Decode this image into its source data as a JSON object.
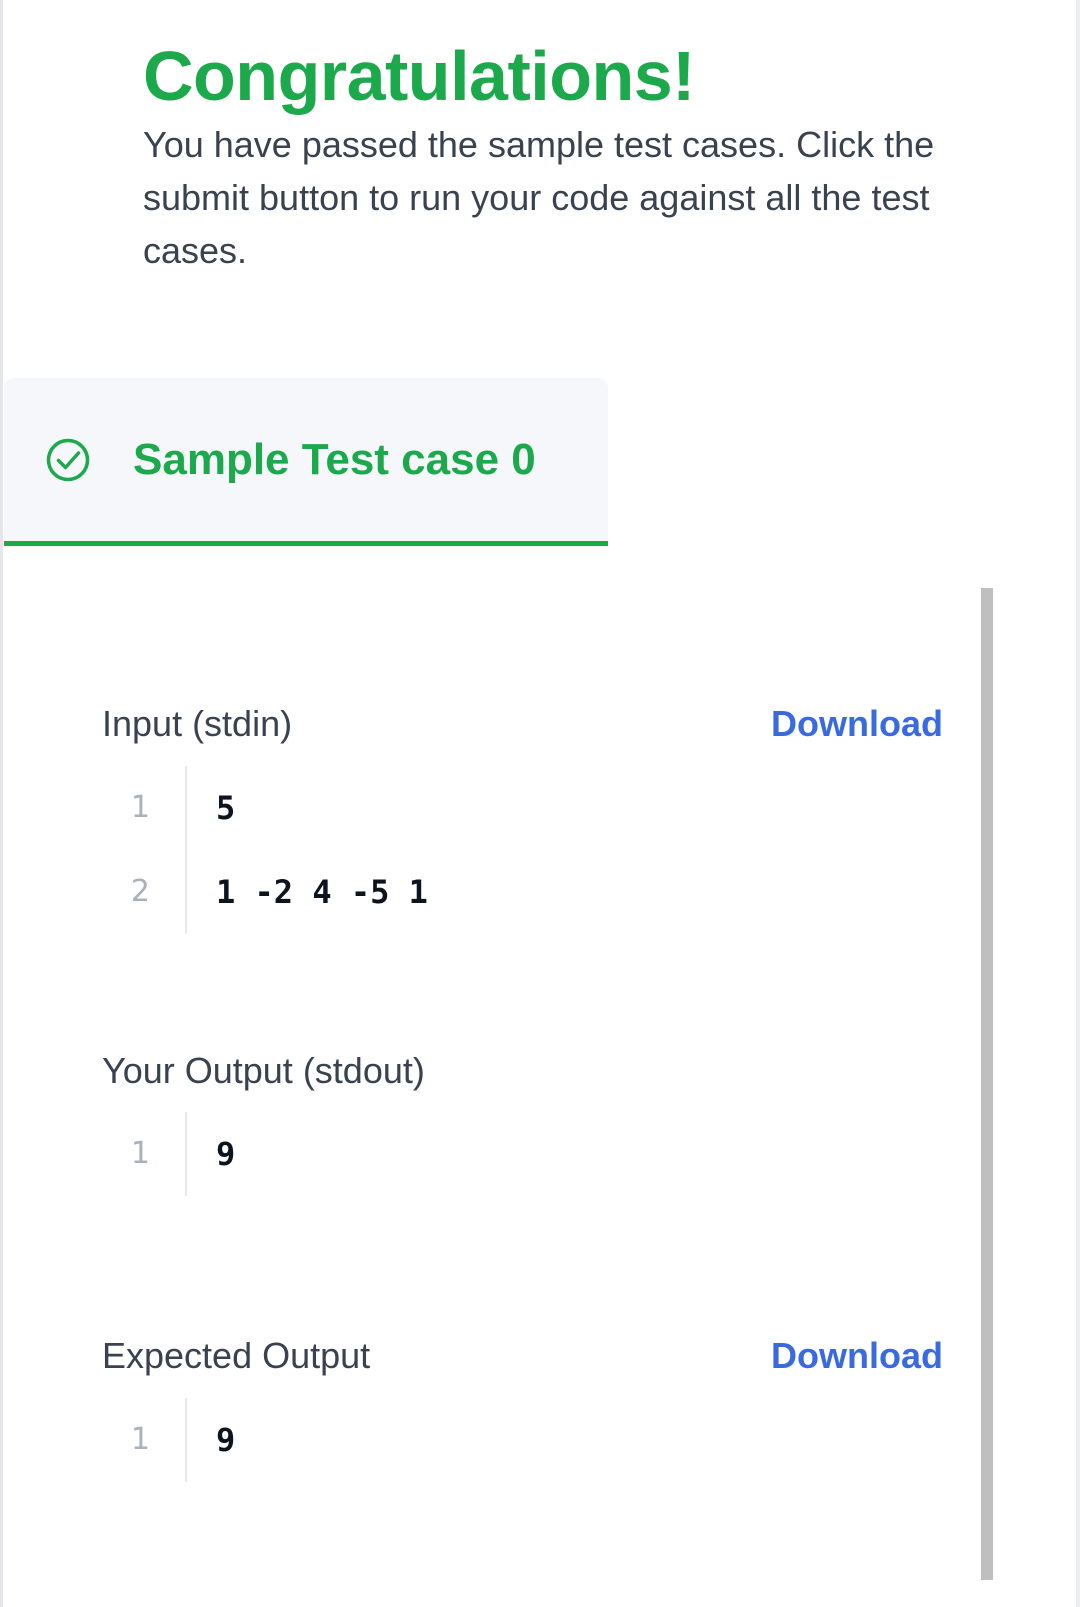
{
  "header": {
    "title": "Congratulations!",
    "message": "You have passed the sample test cases. Click the submit button to run your code against all the test cases."
  },
  "tabs": [
    {
      "label": "Sample Test case 0",
      "status": "passed",
      "icon": "check-circle-icon",
      "selected": true
    }
  ],
  "colors": {
    "success": "#1ba94c",
    "link": "#3a6ae0",
    "tab_background": "#f5f7fb"
  },
  "sections": {
    "input": {
      "label": "Input (stdin)",
      "download_label": "Download",
      "lines": [
        {
          "num": "1",
          "code": "5"
        },
        {
          "num": "2",
          "code": "1 -2 4 -5 1"
        }
      ]
    },
    "output": {
      "label": "Your Output (stdout)",
      "lines": [
        {
          "num": "1",
          "code": "9"
        }
      ]
    },
    "expected": {
      "label": "Expected Output",
      "download_label": "Download",
      "lines": [
        {
          "num": "1",
          "code": "9"
        }
      ]
    }
  }
}
